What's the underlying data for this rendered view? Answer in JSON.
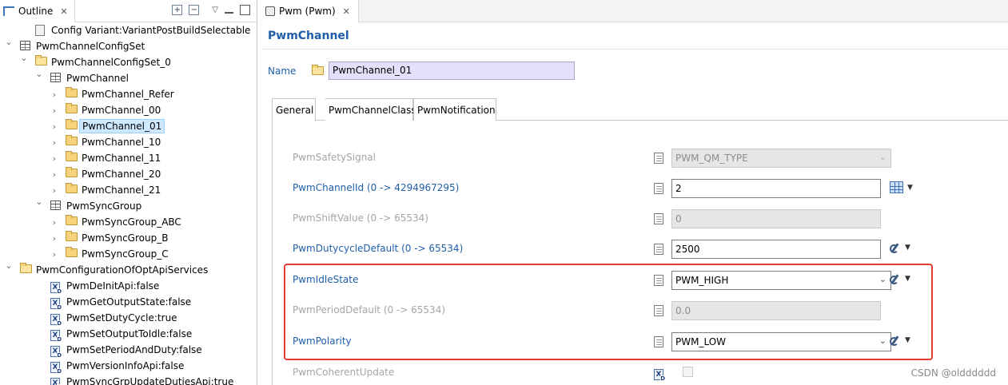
{
  "outline": {
    "tab_label": "Outline",
    "tree": [
      {
        "label": "Config Variant:VariantPostBuildSelectable",
        "level": 1,
        "twisty": "",
        "icon": "config-icon"
      },
      {
        "label": "PwmChannelConfigSet",
        "level": 0,
        "twisty": "expanded",
        "icon": "table-icon"
      },
      {
        "label": "PwmChannelConfigSet_0",
        "level": 1,
        "twisty": "expanded",
        "icon": "folder-open-icon"
      },
      {
        "label": "PwmChannel",
        "level": 2,
        "twisty": "expanded",
        "icon": "table-icon"
      },
      {
        "label": "PwmChannel_Refer",
        "level": 3,
        "twisty": "collapsed",
        "icon": "folder-icon"
      },
      {
        "label": "PwmChannel_00",
        "level": 3,
        "twisty": "collapsed",
        "icon": "folder-icon"
      },
      {
        "label": "PwmChannel_01",
        "level": 3,
        "twisty": "collapsed",
        "icon": "folder-icon",
        "selected": true
      },
      {
        "label": "PwmChannel_10",
        "level": 3,
        "twisty": "collapsed",
        "icon": "folder-icon"
      },
      {
        "label": "PwmChannel_11",
        "level": 3,
        "twisty": "collapsed",
        "icon": "folder-icon"
      },
      {
        "label": "PwmChannel_20",
        "level": 3,
        "twisty": "collapsed",
        "icon": "folder-icon"
      },
      {
        "label": "PwmChannel_21",
        "level": 3,
        "twisty": "collapsed",
        "icon": "folder-icon"
      },
      {
        "label": "PwmSyncGroup",
        "level": 2,
        "twisty": "expanded",
        "icon": "table-icon"
      },
      {
        "label": "PwmSyncGroup_ABC",
        "level": 3,
        "twisty": "collapsed",
        "icon": "folder-icon"
      },
      {
        "label": "PwmSyncGroup_B",
        "level": 3,
        "twisty": "collapsed",
        "icon": "folder-icon"
      },
      {
        "label": "PwmSyncGroup_C",
        "level": 3,
        "twisty": "collapsed",
        "icon": "folder-icon"
      },
      {
        "label": "PwmConfigurationOfOptApiServices",
        "level": 0,
        "twisty": "expanded",
        "icon": "folder-open-icon"
      },
      {
        "label": "PwmDeInitApi:false",
        "level": 2,
        "twisty": "",
        "icon": "boolean-param-icon"
      },
      {
        "label": "PwmGetOutputState:false",
        "level": 2,
        "twisty": "",
        "icon": "boolean-param-icon"
      },
      {
        "label": "PwmSetDutyCycle:true",
        "level": 2,
        "twisty": "",
        "icon": "boolean-param-icon"
      },
      {
        "label": "PwmSetOutputToIdle:false",
        "level": 2,
        "twisty": "",
        "icon": "boolean-param-icon"
      },
      {
        "label": "PwmSetPeriodAndDuty:false",
        "level": 2,
        "twisty": "",
        "icon": "boolean-param-icon"
      },
      {
        "label": "PwmVersionInfoApi:false",
        "level": 2,
        "twisty": "",
        "icon": "boolean-param-icon"
      },
      {
        "label": "PwmSyncGrpUpdateDutiesApi:true",
        "level": 2,
        "twisty": "",
        "icon": "boolean-param-icon"
      }
    ]
  },
  "editor": {
    "tab_label": "Pwm (Pwm)",
    "title": "PwmChannel",
    "name_label": "Name",
    "name_value": "PwmChannel_01",
    "tabs": [
      "General",
      "PwmChannelClass",
      "PwmNotification"
    ],
    "active_tab": "General",
    "params": [
      {
        "label": "PwmSafetySignal",
        "value": "PWM_QM_TYPE",
        "kind": "combo",
        "enabled": false,
        "icon": "enum-param-icon",
        "extra": ""
      },
      {
        "label": "PwmChannelId (0 -> 4294967295)",
        "value": "2",
        "kind": "text",
        "enabled": true,
        "icon": "numeric-param-icon",
        "extra": "calculator-icon"
      },
      {
        "label": "PwmShiftValue (0 -> 65534)",
        "value": "0",
        "kind": "text",
        "enabled": false,
        "icon": "numeric-param-icon",
        "extra": ""
      },
      {
        "label": "PwmDutycycleDefault (0 -> 65534)",
        "value": "2500",
        "kind": "text",
        "enabled": true,
        "icon": "numeric-param-icon",
        "extra": "wand-icon"
      },
      {
        "label": "PwmIdleState",
        "value": "PWM_HIGH",
        "kind": "combo",
        "enabled": true,
        "icon": "enum-param-icon",
        "extra": "wand-icon"
      },
      {
        "label": "PwmPeriodDefault (0 -> 65534)",
        "value": "0.0",
        "kind": "text",
        "enabled": false,
        "icon": "numeric-param-icon",
        "extra": ""
      },
      {
        "label": "PwmPolarity",
        "value": "PWM_LOW",
        "kind": "combo",
        "enabled": true,
        "icon": "enum-param-icon",
        "extra": "wand-icon"
      },
      {
        "label": "PwmCoherentUpdate",
        "value": "",
        "kind": "checkbox",
        "enabled": false,
        "icon": "boolean-param-icon",
        "extra": ""
      }
    ]
  },
  "watermark": "CSDN @oldddddd",
  "colors": {
    "accent_blue": "#1f5ea8",
    "selection": "#cde8ff",
    "highlight_red": "#e23a2f",
    "name_field": "#e4e0fb"
  }
}
